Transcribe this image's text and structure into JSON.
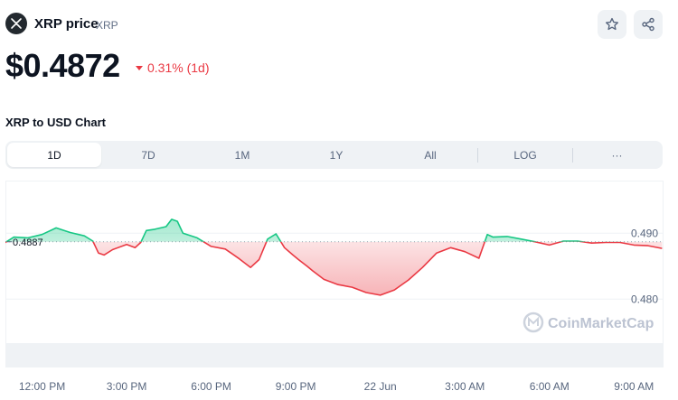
{
  "header": {
    "coin_name": "XRP price",
    "ticker": "XRP",
    "logo_icon": "xrp-logo-icon",
    "star_icon": "star-icon",
    "share_icon": "share-icon"
  },
  "price": {
    "value": "$0.4872",
    "change": "0.31% (1d)",
    "direction": "down"
  },
  "chart_title": "XRP to USD Chart",
  "tabs": [
    {
      "label": "1D",
      "active": true
    },
    {
      "label": "7D",
      "active": false
    },
    {
      "label": "1M",
      "active": false
    },
    {
      "label": "1Y",
      "active": false
    },
    {
      "label": "All",
      "active": false
    },
    {
      "label": "LOG",
      "active": false
    },
    {
      "label": "···",
      "active": false
    }
  ],
  "colors": {
    "up": "#16c784",
    "down": "#ea3943",
    "text": "#0d1421",
    "muted": "#58667e"
  },
  "watermark": "CoinMarketCap",
  "chart_data": {
    "type": "line",
    "baseline_value": 0.4887,
    "baseline_label": "0.4887",
    "x_tick_labels": [
      "12:00 PM",
      "3:00 PM",
      "6:00 PM",
      "9:00 PM",
      "22 Jun",
      "3:00 AM",
      "6:00 AM",
      "9:00 AM"
    ],
    "y_tick_labels": [
      "0.490",
      "0.480"
    ],
    "y_ticks": [
      0.49,
      0.48
    ],
    "ylim": [
      0.4736,
      0.4962
    ],
    "xlim": [
      -1.3,
      22.05
    ],
    "x_hours_from_noon": [
      -1.6,
      -1.3,
      -1.0,
      -0.5,
      0.0,
      0.5,
      1.0,
      1.5,
      1.8,
      2.0,
      2.2,
      2.5,
      3.0,
      3.3,
      3.5,
      3.7,
      4.0,
      4.4,
      4.6,
      4.8,
      5.0,
      5.5,
      6.0,
      6.5,
      7.0,
      7.4,
      7.7,
      8.0,
      8.3,
      8.6,
      8.9,
      9.1,
      9.4,
      9.6,
      10.0,
      10.5,
      11.0,
      11.5,
      12.0,
      12.5,
      13.0,
      13.5,
      14.0,
      14.5,
      15.0,
      15.5,
      15.8,
      16.0,
      16.5,
      17.0,
      17.5,
      18.0,
      18.5,
      19.0,
      19.5,
      20.0,
      20.5,
      21.0,
      21.5,
      22.0
    ],
    "values": [
      0.4886,
      0.4886,
      0.4894,
      0.4893,
      0.4898,
      0.4908,
      0.4901,
      0.4896,
      0.4888,
      0.487,
      0.4867,
      0.4875,
      0.4883,
      0.4878,
      0.4886,
      0.4904,
      0.4906,
      0.491,
      0.4921,
      0.4918,
      0.49,
      0.4893,
      0.488,
      0.4876,
      0.4861,
      0.4848,
      0.486,
      0.4891,
      0.4899,
      0.4878,
      0.4867,
      0.486,
      0.485,
      0.4843,
      0.483,
      0.4822,
      0.4818,
      0.481,
      0.4806,
      0.4814,
      0.4829,
      0.4848,
      0.487,
      0.4878,
      0.4872,
      0.4862,
      0.4898,
      0.4894,
      0.4895,
      0.4891,
      0.4887,
      0.4882,
      0.4888,
      0.4888,
      0.4885,
      0.4886,
      0.4886,
      0.4882,
      0.4881,
      0.4877
    ],
    "volume_visible": true
  }
}
